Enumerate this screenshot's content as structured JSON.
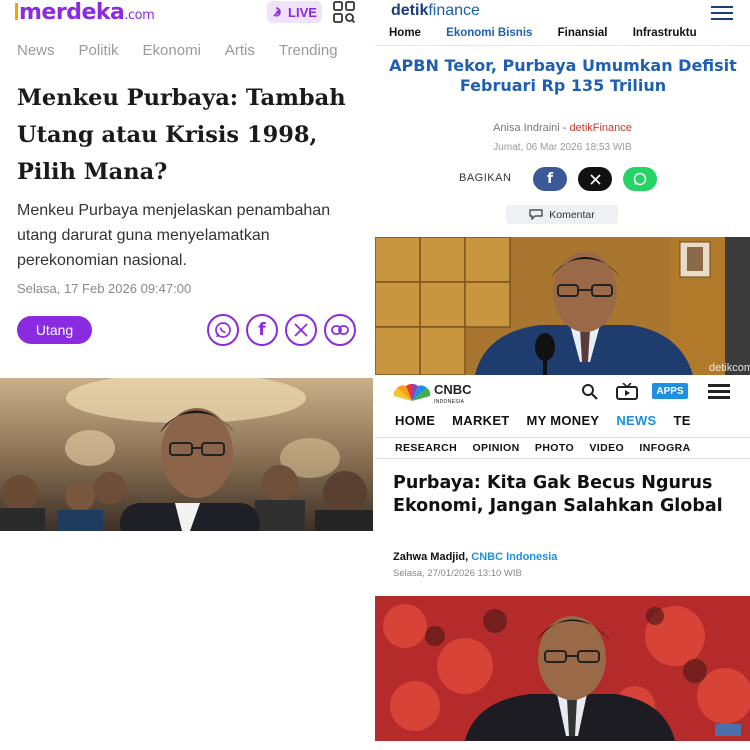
{
  "merdeka": {
    "logo": "merdeka",
    "logo_suffix": ".com",
    "live_label": "LIVE",
    "nav": [
      "News",
      "Politik",
      "Ekonomi",
      "Artis",
      "Trending"
    ],
    "title": "Menkeu Purbaya: Tambah Utang atau Krisis 1998, Pilih Mana?",
    "summary": "Menkeu Purbaya menjelaskan penambahan utang darurat guna menyelamatkan perekonomian nasional.",
    "date": "Selasa, 17 Feb 2026 09:47:00",
    "tag": "Utang",
    "share_icons": [
      "whatsapp-icon",
      "facebook-icon",
      "x-icon",
      "link-icon"
    ],
    "accent": "#8a2be2"
  },
  "detik": {
    "logo_main": "detik",
    "logo_sub": "finance",
    "nav": [
      "Home",
      "Ekonomi Bisnis",
      "Finansial",
      "Infrastruktu"
    ],
    "active_nav": "Ekonomi Bisnis",
    "title": "APBN Tekor, Purbaya Umumkan Defisit Februari Rp 135 Triliun",
    "author": "Anisa Indraini",
    "author_sep": " - ",
    "source": "detikFinance",
    "date": "Jumat, 06 Mar 2026 18:53 WIB",
    "share_label": "BAGIKAN",
    "comment_label": "Komentar",
    "watermark": "detikcom",
    "accent": "#1f5fb3"
  },
  "cnbc": {
    "logo": "CNBC",
    "logo_sub": "INDONESIA",
    "apps_label": "APPS",
    "nav_main": [
      "HOME",
      "MARKET",
      "MY MONEY",
      "NEWS",
      "TE"
    ],
    "active_nav": "NEWS",
    "nav_sub": [
      "RESEARCH",
      "OPINION",
      "PHOTO",
      "VIDEO",
      "INFOGRA"
    ],
    "title": "Purbaya: Kita Gak Becus Ngurus Ekonomi, Jangan Salahkan Global",
    "author": "Zahwa Madjid",
    "author_sep": ", ",
    "source": "CNBC Indonesia",
    "date": "Selasa, 27/01/2026 13:10 WIB",
    "accent": "#1f8fe0"
  }
}
